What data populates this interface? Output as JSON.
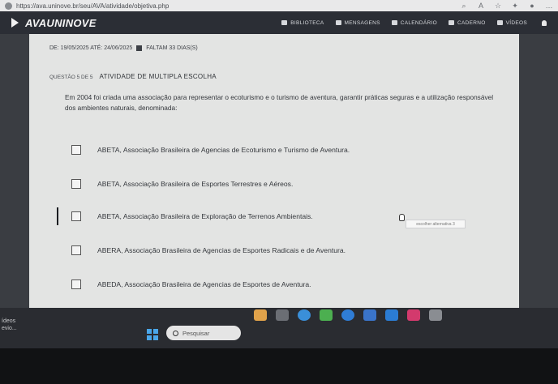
{
  "browser": {
    "url": "https://ava.uninove.br/seu/AVA/atividade/objetiva.php"
  },
  "site": {
    "logo": "AVAUNINOVE",
    "nav": [
      {
        "label": "BIBLIOTECA",
        "icon": "book-icon"
      },
      {
        "label": "MENSAGENS",
        "icon": "mail-icon"
      },
      {
        "label": "CALENDÁRIO",
        "icon": "calendar-icon"
      },
      {
        "label": "CADERNO",
        "icon": "notebook-icon"
      },
      {
        "label": "VÍDEOS",
        "icon": "video-icon"
      }
    ]
  },
  "activity": {
    "dates": "DE: 19/05/2025  ATÉ: 24/06/2025",
    "remaining": "FALTAM 33 DIAS(S)",
    "question_number": "QUESTÃO 5 DE 5",
    "question_title": "ATIVIDADE DE MULTIPLA ESCOLHA",
    "question_text": "Em 2004 foi criada uma associação para representar o ecoturismo e o turismo de aventura, garantir práticas seguras e a utilização responsável dos ambientes naturais, denominada:",
    "options": [
      "ABETA, Associação Brasileira de Agencias de Ecoturismo e Turismo de Aventura.",
      "ABETA, Associação Brasileira de Esportes Terrestres e Aéreos.",
      "ABETA, Associação Brasileira de Exploração de Terrenos Ambientais.",
      "ABERA, Associação Brasileira de Agencias de Esportes Radicais e de Aventura.",
      "ABEDA, Associação Brasileira de Agencias de Esportes de Aventura."
    ],
    "tooltip": "escolher alternativa 3"
  },
  "taskbar": {
    "left_line1": "ídeos",
    "left_line2": "evio...",
    "search_placeholder": "Pesquisar"
  },
  "colors": {
    "header": "#2b2e35",
    "content": "#e3e4e3",
    "taskbar": "#2a2c31",
    "start": "#4aa7ea"
  }
}
